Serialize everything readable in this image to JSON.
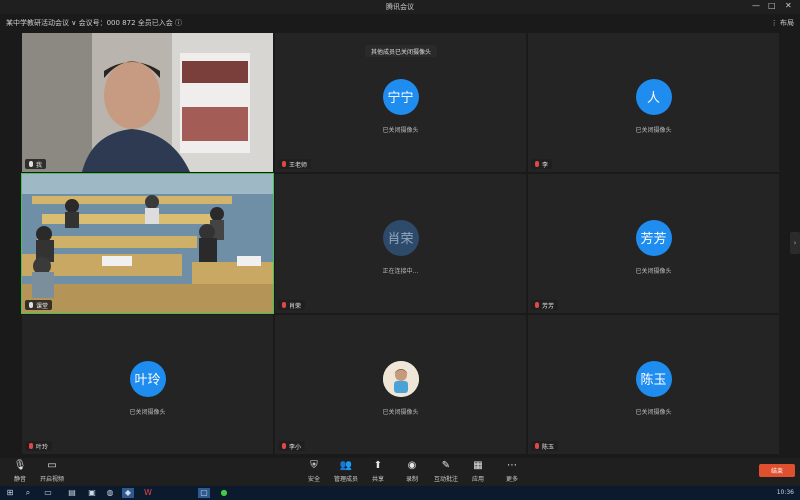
{
  "window": {
    "title": "腾讯会议",
    "controls": [
      "—",
      "□",
      "✕"
    ]
  },
  "meeting": {
    "info": "某中学教研活动会议  ∨   会议号：000 872   全员已入会  ⓘ",
    "right_label": "⋮ 布局"
  },
  "notice": "其他成员已关闭摄像头",
  "tiles": [
    {
      "id": "t1",
      "type": "video",
      "tag": "我",
      "muted": false
    },
    {
      "id": "t2",
      "type": "avatar",
      "avatar": "宁宁",
      "sub": "已关闭摄像头",
      "tag": "王老师",
      "muted": true
    },
    {
      "id": "t3",
      "type": "avatar",
      "avatar": "人",
      "sub": "已关闭摄像头",
      "tag": "李",
      "muted": true
    },
    {
      "id": "t4",
      "type": "video",
      "tag": "课堂",
      "muted": false,
      "active": true
    },
    {
      "id": "t5",
      "type": "avatar",
      "avatar": "肖荣",
      "grey": true,
      "sub": "正在连接中...",
      "tag": "肖荣",
      "muted": true
    },
    {
      "id": "t6",
      "type": "avatar",
      "avatar": "芳芳",
      "sub": "已关闭摄像头",
      "tag": "芳芳",
      "muted": true
    },
    {
      "id": "t7",
      "type": "avatar",
      "avatar": "叶玲",
      "sub": "已关闭摄像头",
      "tag": "叶玲",
      "muted": true
    },
    {
      "id": "t8",
      "type": "photo",
      "sub": "已关闭摄像头",
      "tag": "李小",
      "muted": true
    },
    {
      "id": "t9",
      "type": "avatar",
      "avatar": "陈玉",
      "sub": "已关闭摄像头",
      "tag": "陈玉",
      "muted": true
    }
  ],
  "toolbar": {
    "left": [
      {
        "icon": "🎙",
        "label": "静音"
      },
      {
        "icon": "▭",
        "label": "开启视频"
      }
    ],
    "center": [
      {
        "icon": "⛨",
        "label": "安全"
      },
      {
        "icon": "👥",
        "label": "管理成员"
      },
      {
        "icon": "⬆",
        "label": "共享"
      },
      {
        "icon": "◉",
        "label": "录制"
      },
      {
        "icon": "✎",
        "label": "互动批注"
      },
      {
        "icon": "▦",
        "label": "应用"
      },
      {
        "icon": "⋯",
        "label": "更多"
      }
    ],
    "end_label": "结束"
  },
  "taskbar": {
    "time": "10:36"
  }
}
